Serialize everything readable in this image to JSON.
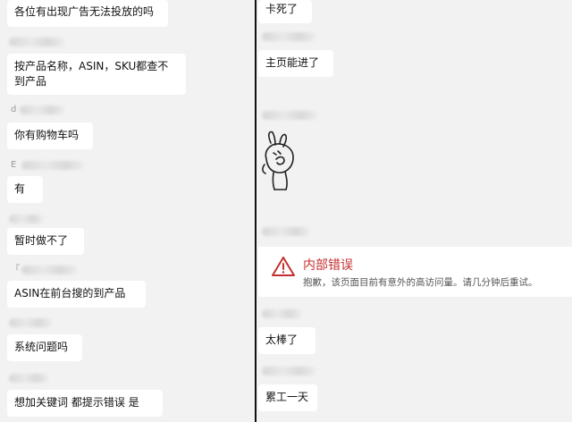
{
  "left_panel": {
    "messages": [
      {
        "text": "各位有出现广告无法投放的吗"
      },
      {
        "text": "按产品名称，ASIN，SKU都查不到产品"
      },
      {
        "text": "你有购物车吗"
      },
      {
        "text": "有"
      },
      {
        "text": "暂时做不了"
      },
      {
        "text": "ASIN在前台搜的到产品"
      },
      {
        "text": "系统问题吗"
      },
      {
        "text": "想加关键词 都提示错误 是"
      }
    ],
    "sender_hints": [
      "d",
      "E",
      "『"
    ]
  },
  "right_panel": {
    "messages": [
      {
        "text": "卡死了"
      },
      {
        "text": "主页能进了"
      },
      {
        "text": "太棒了"
      },
      {
        "text": "累工一天"
      }
    ],
    "error": {
      "icon": "warning-triangle-icon",
      "title": "内部错误",
      "description": "抱歉，该页面目前有意外的高访问量。请几分钟后重试。",
      "accent_color": "#c62f2f"
    },
    "sticker": "rabbit-sticker"
  },
  "colors": {
    "background": "#f2f2f2",
    "bubble": "#ffffff",
    "divider": "#111111"
  }
}
